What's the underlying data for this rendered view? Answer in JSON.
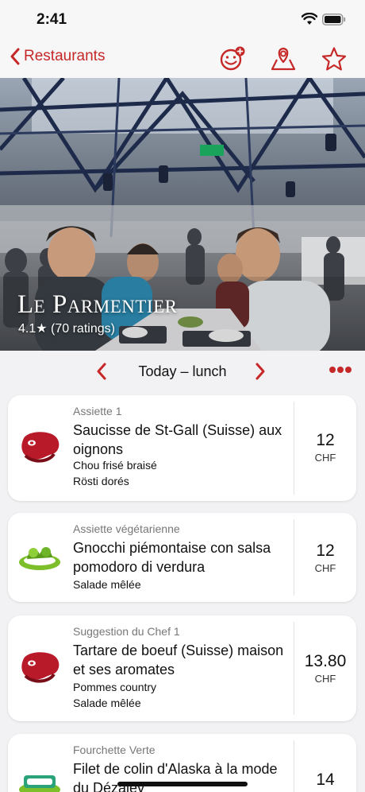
{
  "status": {
    "time": "2:41"
  },
  "nav": {
    "back_label": "Restaurants"
  },
  "restaurant": {
    "name": "Le Parmentier",
    "rating": "4.1★ (70 ratings)"
  },
  "day": {
    "label": "Today – lunch"
  },
  "menu": [
    {
      "category": "Assiette 1",
      "title": "Saucisse de St-Gall (Suisse) aux oignons",
      "sides": [
        "Chou frisé braisé",
        "Rösti dorés"
      ],
      "price": "12",
      "currency": "CHF",
      "icon": "meat-icon"
    },
    {
      "category": "Assiette végétarienne",
      "title": "Gnocchi piémontaise con salsa pomodoro di verdura",
      "sides": [
        "Salade mêlée"
      ],
      "price": "12",
      "currency": "CHF",
      "icon": "vegetarian-icon"
    },
    {
      "category": "Suggestion du Chef 1",
      "title": "Tartare de boeuf (Suisse) maison et ses aromates",
      "sides": [
        "Pommes country",
        "Salade mêlée"
      ],
      "price": "13.80",
      "currency": "CHF",
      "icon": "meat-icon"
    },
    {
      "category": "Fourchette Verte",
      "title": "Filet de colin d'Alaska à la mode du Dézaley",
      "sides": [],
      "price": "14",
      "currency": "",
      "icon": "fish-icon"
    }
  ],
  "colors": {
    "accent": "#c62828"
  }
}
